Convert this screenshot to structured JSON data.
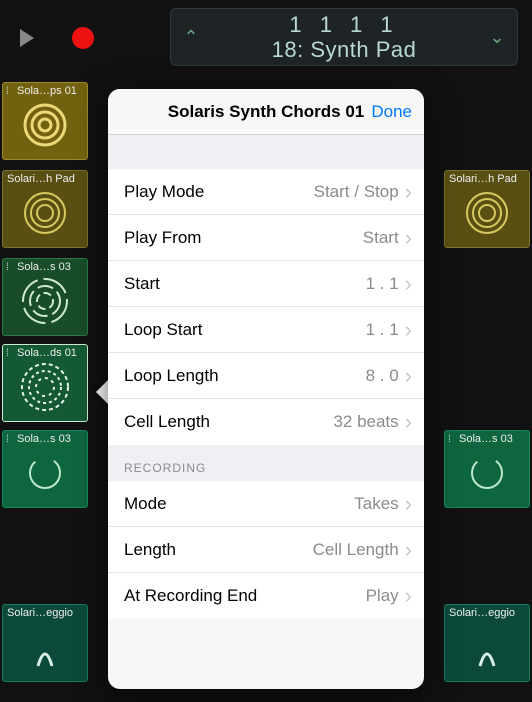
{
  "transport": {
    "position": "1  1  1      1",
    "patch": "18: Synth Pad"
  },
  "popover": {
    "title": "Solaris Synth Chords 01",
    "done": "Done",
    "rows1": [
      {
        "label": "Play Mode",
        "value": "Start / Stop"
      },
      {
        "label": "Play From",
        "value": "Start"
      },
      {
        "label": "Start",
        "value": "1 . 1"
      },
      {
        "label": "Loop Start",
        "value": "1 . 1"
      },
      {
        "label": "Loop Length",
        "value": "8 . 0"
      },
      {
        "label": "Cell Length",
        "value": "32 beats"
      }
    ],
    "section2": "RECORDING",
    "rows2": [
      {
        "label": "Mode",
        "value": "Takes"
      },
      {
        "label": "Length",
        "value": "Cell Length"
      },
      {
        "label": "At Recording End",
        "value": "Play"
      }
    ]
  },
  "cells": {
    "c0": "Sola…ps 01",
    "c1": "Solari…h Pad",
    "c2": "Solari…h Pad",
    "c3": "Sola…s 03",
    "c4": "Sola…ds 01",
    "c5": "Sola…s 03",
    "c6": "Sola…s 03",
    "c7": "Solari…eggio",
    "c8": "Solari…eggio"
  }
}
